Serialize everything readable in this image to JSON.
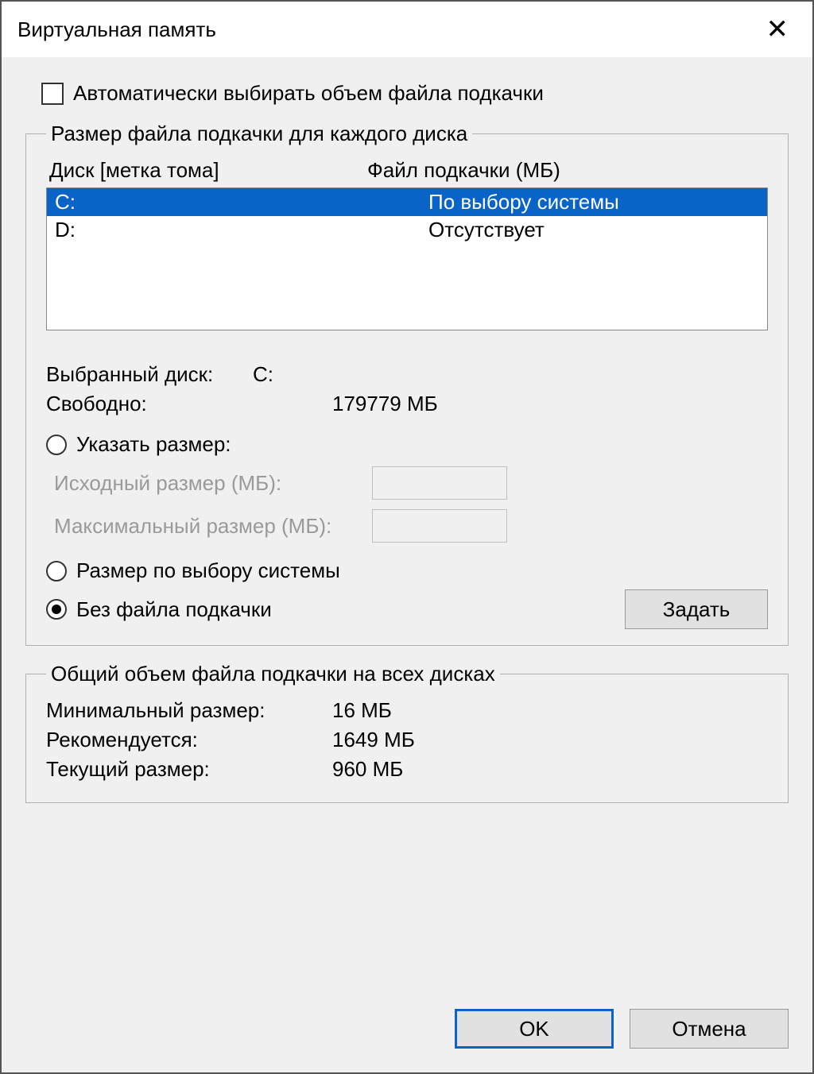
{
  "window": {
    "title": "Виртуальная память"
  },
  "auto_checkbox": {
    "label": "Автоматически выбирать объем файла подкачки",
    "checked": false
  },
  "per_drive": {
    "legend": "Размер файла подкачки для каждого диска",
    "col_drive": "Диск [метка тома]",
    "col_file": "Файл подкачки (МБ)",
    "rows": [
      {
        "drive": "C:",
        "value": "По выбору системы",
        "selected": true
      },
      {
        "drive": "D:",
        "value": "Отсутствует",
        "selected": false
      }
    ],
    "selected_drive_label": "Выбранный диск:",
    "selected_drive_value": "C:",
    "free_label": "Свободно:",
    "free_value": "179779 МБ",
    "radio_custom": "Указать размер:",
    "initial_label": "Исходный размер (МБ):",
    "max_label": "Максимальный размер (МБ):",
    "radio_system": "Размер по выбору системы",
    "radio_none": "Без файла подкачки",
    "set_button": "Задать"
  },
  "totals": {
    "legend": "Общий объем файла подкачки на всех дисках",
    "min_label": "Минимальный размер:",
    "min_value": "16 МБ",
    "rec_label": "Рекомендуется:",
    "rec_value": "1649 МБ",
    "cur_label": "Текущий размер:",
    "cur_value": "960 МБ"
  },
  "buttons": {
    "ok": "OK",
    "cancel": "Отмена"
  }
}
